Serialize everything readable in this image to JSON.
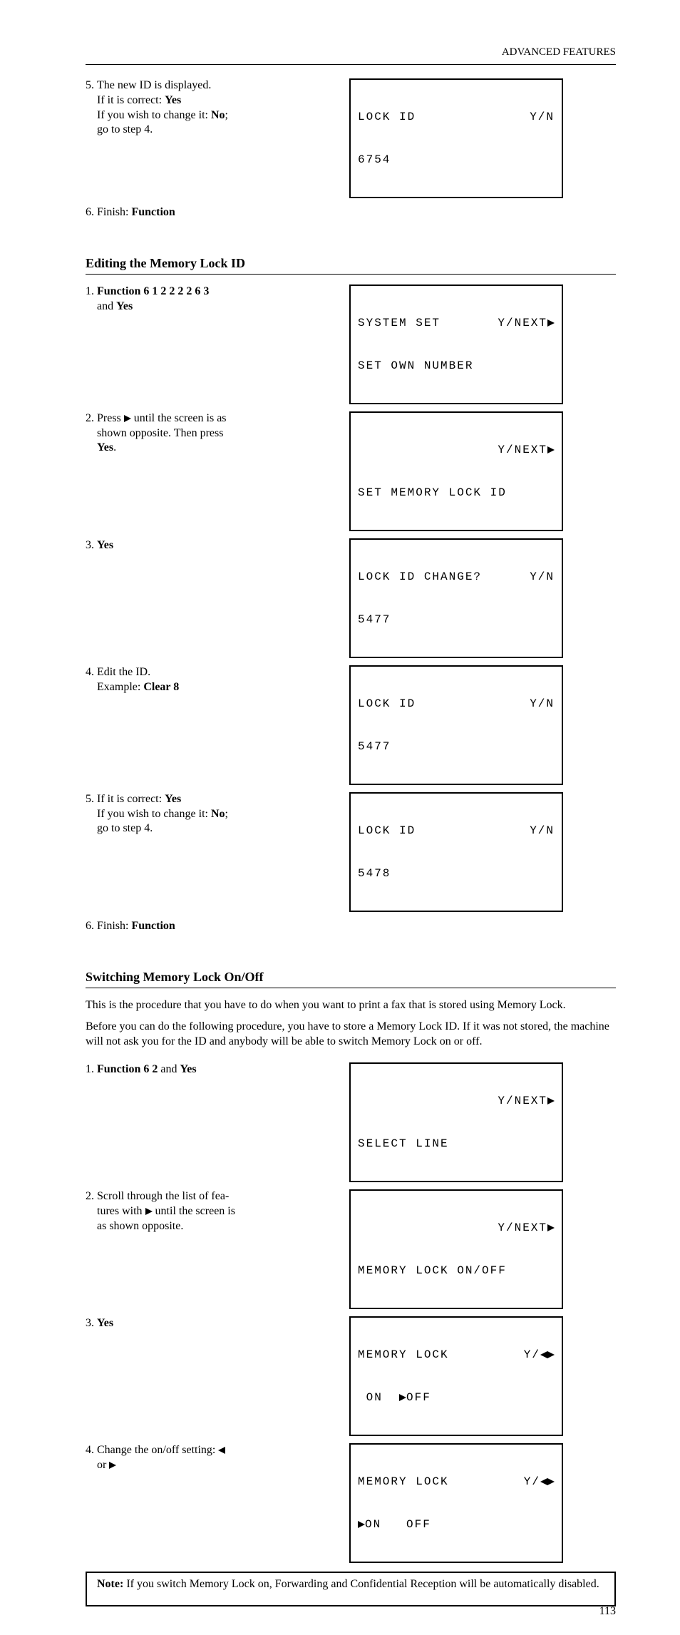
{
  "header": {
    "right": "ADVANCED FEATURES"
  },
  "block1": {
    "step5_left": "5. The new ID is displayed.\n    If it is correct: Yes\n    If you wish to change it: No;\n    go to step 4.",
    "step6_left": "6. Finish: Function",
    "lcd5": {
      "l1_left": "LOCK ID",
      "l1_right": "Y/N",
      "l2": "6754"
    }
  },
  "section_edit": {
    "title": "Editing the Memory Lock ID",
    "intro_left": "1. Function 6 1 2 2 2 2 6 3\n    and Yes",
    "intro_sub": "2. Press ▶ until the screen is as\n    shown opposite. Then press\n    Yes.",
    "step3": "3. Yes",
    "step4": "4. Edit the ID.\n    Example: Clear 8",
    "step5": "5. If it is correct: Yes\n    If you wish to change it: No;\n    go to step 4.",
    "step6": "6. Finish: Function",
    "lcd1": {
      "l1_left": "SYSTEM SET",
      "l1_right": "Y/NEXT▶",
      "l2": "SET OWN NUMBER"
    },
    "lcd2": {
      "l1_right": "Y/NEXT▶",
      "l2": "SET MEMORY LOCK ID"
    },
    "lcd3": {
      "l1_left": "LOCK ID CHANGE?",
      "l1_right": "Y/N",
      "l2": "5477"
    },
    "lcd4": {
      "l1_left": "LOCK ID",
      "l1_right": "Y/N",
      "l2": "5477"
    },
    "lcd5": {
      "l1_left": "LOCK ID",
      "l1_right": "Y/N",
      "l2": "5478"
    }
  },
  "section_switch": {
    "title": "Switching Memory Lock On/Off",
    "para": "This is the procedure that you have to do when you want to print a fax that is stored using Memory Lock.",
    "para2": "Before you can do the following procedure, you have to store a Memory Lock ID. If it was not stored, the machine will not ask you for the ID and anybody will be able to switch Memory Lock on or off.",
    "step1": "1. Function 6 2 and Yes",
    "step2": "2. Scroll through the list of fea-\n    tures with ▶ until the screen is\n    as shown opposite.",
    "step3": "3. Yes",
    "step4": "4. Change the on/off setting: ◀\n    or ▶",
    "lcd1": {
      "l1_right": "Y/NEXT▶",
      "l2": "SELECT LINE"
    },
    "lcd2": {
      "l1_right": "Y/NEXT▶",
      "l2": "MEMORY LOCK ON/OFF"
    },
    "lcd3": {
      "l1_left": "MEMORY LOCK",
      "l1_right": "Y/◀▶",
      "l2": " ON  ▶OFF"
    },
    "lcd4": {
      "l1_left": "MEMORY LOCK",
      "l1_right": "Y/◀▶",
      "l2": "▶ON   OFF"
    }
  },
  "note": {
    "label": "Note:",
    "text": "If you switch Memory Lock on, Forwarding and Confidential Reception will be automatically disabled."
  },
  "page_number": "113"
}
